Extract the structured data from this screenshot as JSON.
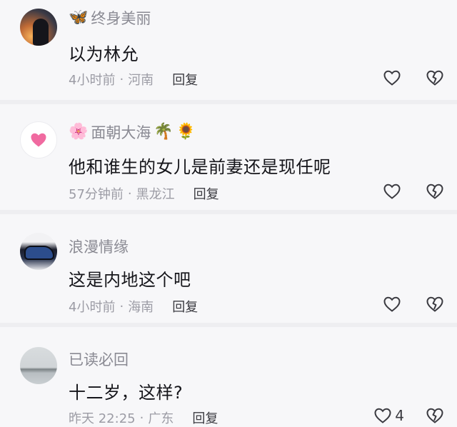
{
  "comments": [
    {
      "username": "终身美丽",
      "prefix_emoji": "🦋",
      "suffix_emojis": [],
      "avatar": "sunset-silhouette-avatar",
      "text": "以为林允",
      "time": "4小时前",
      "location": "河南",
      "reply_label": "回复",
      "like_count": ""
    },
    {
      "username": "面朝大海",
      "prefix_emoji": "🌸",
      "suffix_emojis": [
        "🌴",
        "🌻"
      ],
      "avatar": "pink-heart-avatar",
      "text": "他和谁生的女儿是前妻还是现任呢",
      "time": "57分钟前",
      "location": "黑龙江",
      "reply_label": "回复",
      "like_count": ""
    },
    {
      "username": "浪漫情缘",
      "prefix_emoji": "",
      "suffix_emojis": [],
      "avatar": "car-avatar",
      "text": "这是内地这个吧",
      "time": "4小时前",
      "location": "海南",
      "reply_label": "回复",
      "like_count": ""
    },
    {
      "username": "已读必回",
      "prefix_emoji": "",
      "suffix_emojis": [],
      "avatar": "lake-avatar",
      "text": "十二岁，这样?",
      "time": "昨天 22:25",
      "location": "广东",
      "reply_label": "回复",
      "like_count": "4"
    }
  ],
  "separator": "·",
  "colors": {
    "background": "#f7f7f9",
    "username": "#8a8a93",
    "body_text": "#15151a",
    "meta_text": "#9c9ca5",
    "heart_avatar": "#f06aa0"
  }
}
